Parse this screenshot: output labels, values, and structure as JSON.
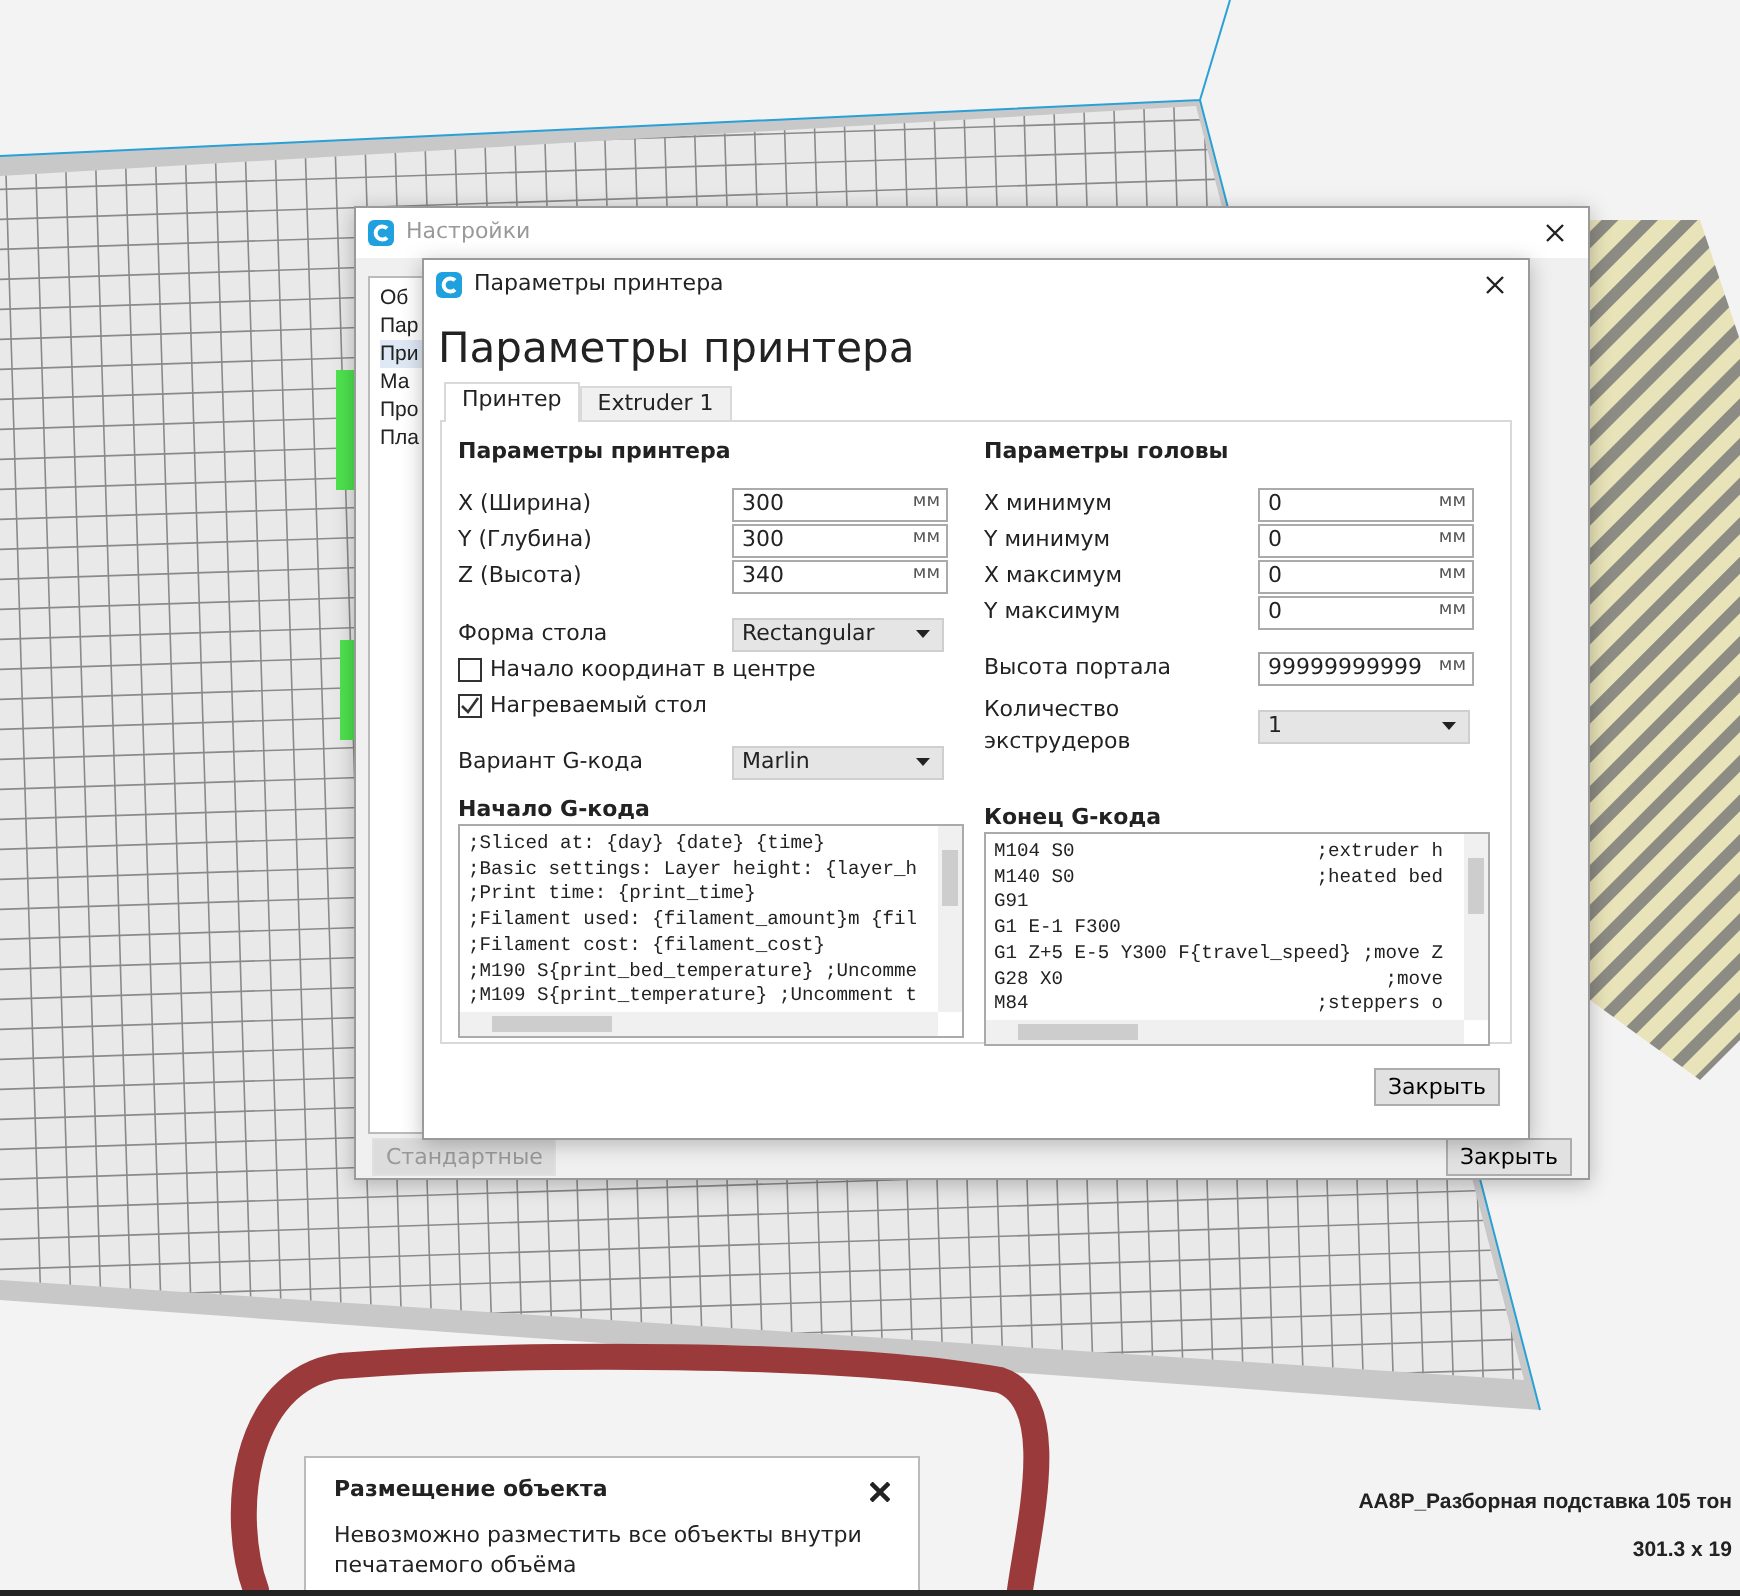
{
  "settings_window": {
    "title": "Настройки",
    "sidebar_items": [
      {
        "label": "Об",
        "selected": false
      },
      {
        "label": "Пар",
        "selected": false
      },
      {
        "label": "При",
        "selected": true
      },
      {
        "label": "Ма",
        "selected": false
      },
      {
        "label": "Про",
        "selected": false
      },
      {
        "label": "Пла",
        "selected": false
      }
    ],
    "buttons": [
      {
        "label": "Стандартные",
        "disabled": true
      },
      {
        "label": "Закрыть",
        "disabled": false
      }
    ]
  },
  "printer_dialog": {
    "title": "Параметры принтера",
    "heading": "Параметры принтера",
    "tabs": [
      {
        "label": "Принтер",
        "selected": true
      },
      {
        "label": "Extruder 1",
        "selected": false
      }
    ],
    "printer_settings": {
      "title": "Параметры принтера",
      "fields": [
        {
          "label": "X (Ширина)",
          "value": "300",
          "unit": "мм"
        },
        {
          "label": "Y (Глубина)",
          "value": "300",
          "unit": "мм"
        },
        {
          "label": "Z (Высота)",
          "value": "340",
          "unit": "мм"
        }
      ],
      "bed_shape": {
        "label": "Форма стола",
        "value": "Rectangular"
      },
      "checkboxes": [
        {
          "label": "Начало координат в центре",
          "checked": false
        },
        {
          "label": "Нагреваемый стол",
          "checked": true
        }
      ],
      "gcode_flavor": {
        "label": "Вариант G-кода",
        "value": "Marlin"
      }
    },
    "head_settings": {
      "title": "Параметры головы",
      "fields": [
        {
          "label": "X минимум",
          "value": "0",
          "unit": "мм"
        },
        {
          "label": "Y минимум",
          "value": "0",
          "unit": "мм"
        },
        {
          "label": "X максимум",
          "value": "0",
          "unit": "мм"
        },
        {
          "label": "Y максимум",
          "value": "0",
          "unit": "мм"
        }
      ],
      "gantry_height": {
        "label": "Высота портала",
        "value": "99999999999",
        "unit": "мм"
      },
      "extruder_count": {
        "label": "Количество экструдеров",
        "value": "1"
      }
    },
    "start_gcode": {
      "title": "Начало G-кода",
      "lines": [
        ";Sliced at: {day} {date} {time}",
        ";Basic settings: Layer height: {layer_h",
        ";Print time: {print_time}",
        ";Filament used: {filament_amount}m {fil",
        ";Filament cost: {filament_cost}",
        ";M190 S{print_bed_temperature} ;Uncomme",
        ";M109 S{print_temperature} ;Uncomment t"
      ]
    },
    "end_gcode": {
      "title": "Конец G-кода",
      "lines": [
        "M104 S0                     ;extruder h",
        "M140 S0                     ;heated bed",
        "G91",
        "G1 E-1 F300",
        "G1 Z+5 E-5 Y300 F{travel_speed} ;move Z",
        "G28 X0                            ;move",
        "M84                         ;steppers o"
      ]
    },
    "close_button": "Закрыть"
  },
  "notification": {
    "title": "Размещение объекта",
    "message": "Невозможно разместить все объекты внутри печатаемого объёма"
  },
  "object_info": {
    "name": "AA8P_Разборная подставка 105 тон",
    "dimensions": "301.3 x 19"
  }
}
